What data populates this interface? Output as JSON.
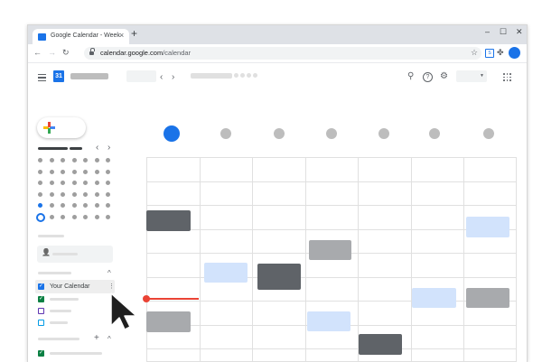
{
  "browser": {
    "tab_title": "Google Calendar - Week",
    "tab_close": "×",
    "new_tab": "+",
    "win_minimize": "–",
    "win_maximize": "☐",
    "win_close": "✕",
    "back": "←",
    "forward": "→",
    "reload": "↻",
    "url_host": "calendar.google.com",
    "url_path": "/calendar",
    "bookmark_star": "☆",
    "extension": "S",
    "puzzle": "✤",
    "menu": "⋮"
  },
  "calendar": {
    "logo_text": "31",
    "prev": "‹",
    "next": "›",
    "mini_prev": "‹",
    "mini_next": "›",
    "search_icon": "⚲",
    "help_icon": "?",
    "settings_icon": "⚙",
    "my_calendars_chevron": "^",
    "other_calendars_add": "+",
    "other_calendars_chevron": "^",
    "people_icon": "👤",
    "kebab": "⋮",
    "checkmark": "✓",
    "calendars": [
      {
        "label": "Your Calendar",
        "color": "#1a73e8",
        "checked": true
      }
    ]
  },
  "colors": {
    "accent": "#1a73e8",
    "now_indicator": "#ea4335",
    "event_dark": "#5f6368",
    "event_grey": "#a8aaad",
    "event_light": "#d2e3fc"
  }
}
